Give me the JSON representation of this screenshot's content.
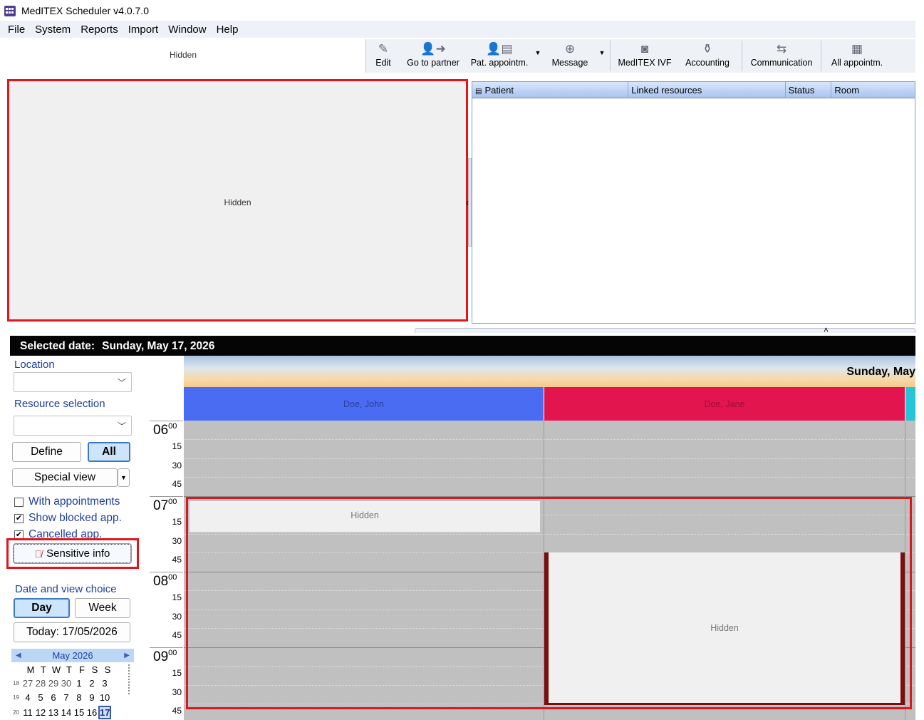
{
  "app": {
    "title": "MedITEX Scheduler v4.0.7.0"
  },
  "menu": [
    "File",
    "System",
    "Reports",
    "Import",
    "Window",
    "Help"
  ],
  "toolbar": {
    "hidden_label": "Hidden",
    "buttons": [
      {
        "label": "Edit",
        "icon": "edit-icon"
      },
      {
        "label": "Go to partner",
        "icon": "go-to-partner-icon"
      },
      {
        "label": "Pat. appointm.",
        "icon": "patient-appointments-icon"
      },
      {
        "label": "Message",
        "icon": "message-icon"
      },
      {
        "label": "MedITEX IVF",
        "icon": "meditex-ivf-icon"
      },
      {
        "label": "Accounting",
        "icon": "accounting-icon"
      },
      {
        "label": "Communication",
        "icon": "communication-icon"
      },
      {
        "label": "All appointm.",
        "icon": "all-appointments-icon"
      }
    ]
  },
  "top_left_panel": {
    "hidden_label": "Hidden"
  },
  "appointment_list": {
    "columns": [
      "Patient",
      "Linked resources",
      "Status",
      "Room"
    ]
  },
  "selected_date": {
    "label": "Selected date:",
    "value": "Sunday, May 17, 2026"
  },
  "left_panel": {
    "location_label": "Location",
    "location_value": "",
    "resource_selection_label": "Resource selection",
    "resource_selection_value": "",
    "define_label": "Define",
    "all_label": "All",
    "special_view_label": "Special view",
    "checkboxes": [
      {
        "label": "With appointments",
        "checked": false
      },
      {
        "label": "Show blocked app.",
        "checked": true
      },
      {
        "label": "Cancelled app.",
        "checked": true
      }
    ],
    "sensitive_info_label": "Sensitive info",
    "date_view_label": "Date and view choice",
    "day_label": "Day",
    "week_label": "Week",
    "today_label": "Today: 17/05/2026"
  },
  "mini_calendar": {
    "month": "May 2026",
    "weekdays": [
      "M",
      "T",
      "W",
      "T",
      "F",
      "S",
      "S"
    ],
    "weeks": [
      {
        "week": "18",
        "days": [
          "27",
          "28",
          "29",
          "30",
          "1",
          "2",
          "3"
        ]
      },
      {
        "week": "19",
        "days": [
          "4",
          "5",
          "6",
          "7",
          "8",
          "9",
          "10"
        ]
      },
      {
        "week": "20",
        "days": [
          "11",
          "12",
          "13",
          "14",
          "15",
          "16",
          "17"
        ]
      }
    ],
    "selected_day": "17"
  },
  "schedule": {
    "day_title": "Sunday, May",
    "resources": [
      {
        "name": "Doe, John",
        "color": "#4a6cf2"
      },
      {
        "name": "Doe, Jane",
        "color": "#e2154f"
      },
      {
        "name": "",
        "color": "#24c6d6"
      }
    ],
    "hours": [
      "06",
      "07",
      "08",
      "09"
    ],
    "minute_mark": "00",
    "quarters": [
      "15",
      "30",
      "45"
    ],
    "appointments": [
      {
        "resource": "Doe, John",
        "label": "Hidden"
      },
      {
        "resource": "Doe, Jane",
        "label": "Hidden"
      }
    ]
  }
}
